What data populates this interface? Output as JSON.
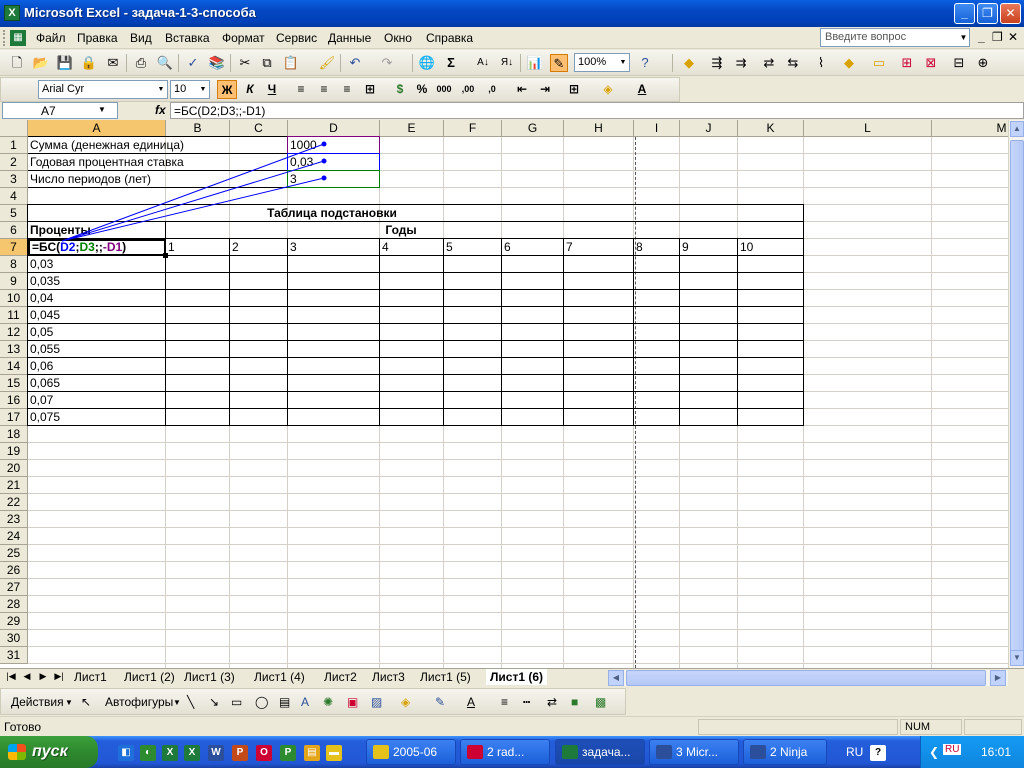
{
  "window": {
    "title": "Microsoft Excel - задача-1-3-способа",
    "app_icon": "X"
  },
  "menu": {
    "items": [
      "Файл",
      "Правка",
      "Вид",
      "Вставка",
      "Формат",
      "Сервис",
      "Данные",
      "Окно",
      "Справка"
    ],
    "help_placeholder": "Введите вопрос"
  },
  "toolbar": {
    "zoom": "100%"
  },
  "format_toolbar": {
    "font": "Arial Cyr",
    "size": "10",
    "bold": "Ж",
    "italic": "К",
    "underline": "Ч"
  },
  "formula_bar": {
    "cell_ref": "A7",
    "fx": "fx",
    "formula": "=БС(D2;D3;;-D1)"
  },
  "columns": [
    "A",
    "B",
    "C",
    "D",
    "E",
    "F",
    "G",
    "H",
    "I",
    "J",
    "K",
    "L",
    "M"
  ],
  "rows": [
    "1",
    "2",
    "3",
    "4",
    "5",
    "6",
    "7",
    "8",
    "9",
    "10",
    "11",
    "12",
    "13",
    "14",
    "15",
    "16",
    "17",
    "18",
    "19",
    "20",
    "21",
    "22",
    "23",
    "24",
    "25",
    "26",
    "27",
    "28",
    "29",
    "30",
    "31"
  ],
  "cells": {
    "a1": "Сумма (денежная единица)",
    "a2": "Годовая процентная ставка",
    "a3": "Число периодов (лет)",
    "d1": "1000",
    "d2": "0,03",
    "d3": "3",
    "table_title": "Таблица подстановки",
    "a6": "Проценты",
    "years_label": "Годы",
    "a7_parts": [
      "=БС(",
      "D2",
      ";",
      "D3",
      ";;",
      "-D1",
      ")"
    ],
    "years": [
      "1",
      "2",
      "3",
      "4",
      "5",
      "6",
      "7",
      "8",
      "9",
      "10"
    ],
    "rates": [
      "0,03",
      "0,035",
      "0,04",
      "0,045",
      "0,05",
      "0,055",
      "0,06",
      "0,065",
      "0,07",
      "0,075"
    ]
  },
  "sheets": [
    "Лист1",
    "Лист1 (2)",
    "Лист1 (3)",
    "Лист1 (4)",
    "Лист2",
    "Лист3",
    "Лист1 (5)",
    "Лист1 (6)"
  ],
  "active_sheet": "Лист1 (6)",
  "drawing_toolbar": {
    "actions": "Действия",
    "autoshapes": "Автофигуры"
  },
  "status": {
    "text": "Готово",
    "num": "NUM"
  },
  "taskbar": {
    "start": "пуск",
    "tasks": [
      "2005-06",
      "2 rad...",
      "задача...",
      "3 Micr...",
      "2 Ninja"
    ],
    "lang": "RU",
    "clock": "16:01"
  },
  "colors": {
    "ref_blue": "#0000ff",
    "ref_green": "#008000",
    "ref_purple": "#800080"
  }
}
